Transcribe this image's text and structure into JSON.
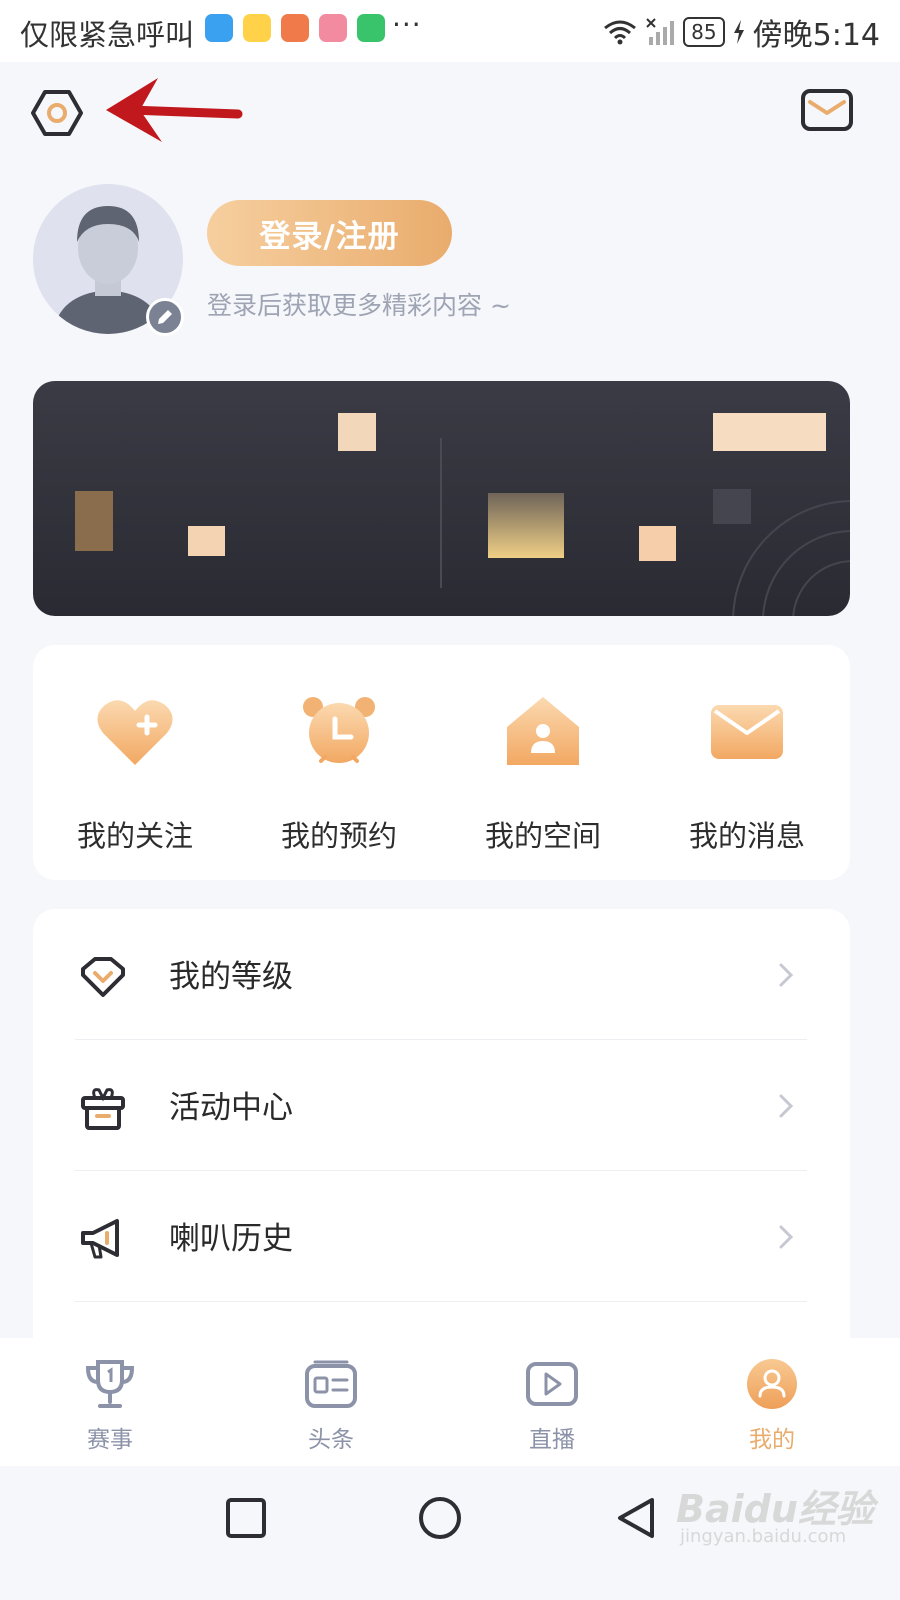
{
  "status_bar": {
    "carrier": "仅限紧急呼叫",
    "more": "···",
    "battery": "85",
    "time": "傍晚5:14"
  },
  "header": {
    "settings_icon": "settings-hexagon-icon",
    "mail_icon": "mail-icon"
  },
  "profile": {
    "login_button": "登录/注册",
    "hint": "登录后获取更多精彩内容 ~"
  },
  "quick_actions": [
    {
      "label": "我的关注",
      "icon": "heart-plus-icon"
    },
    {
      "label": "我的预约",
      "icon": "alarm-clock-icon"
    },
    {
      "label": "我的空间",
      "icon": "house-user-icon"
    },
    {
      "label": "我的消息",
      "icon": "envelope-icon"
    }
  ],
  "menu": [
    {
      "label": "我的等级",
      "icon": "level-diamond-icon"
    },
    {
      "label": "活动中心",
      "icon": "gift-icon"
    },
    {
      "label": "喇叭历史",
      "icon": "megaphone-icon"
    }
  ],
  "bottom_nav": [
    {
      "label": "赛事",
      "icon": "trophy-icon",
      "active": false
    },
    {
      "label": "头条",
      "icon": "news-icon",
      "active": false
    },
    {
      "label": "直播",
      "icon": "play-icon",
      "active": false
    },
    {
      "label": "我的",
      "icon": "user-icon",
      "active": true
    }
  ],
  "watermark": {
    "main": "Baidu经验",
    "sub": "jingyan.baidu.com"
  },
  "colors": {
    "accent": "#e9ac6d",
    "accent_light": "#f6cf9f",
    "nav_inactive": "#8c93a8",
    "banner_bg": "#2f2f38"
  }
}
